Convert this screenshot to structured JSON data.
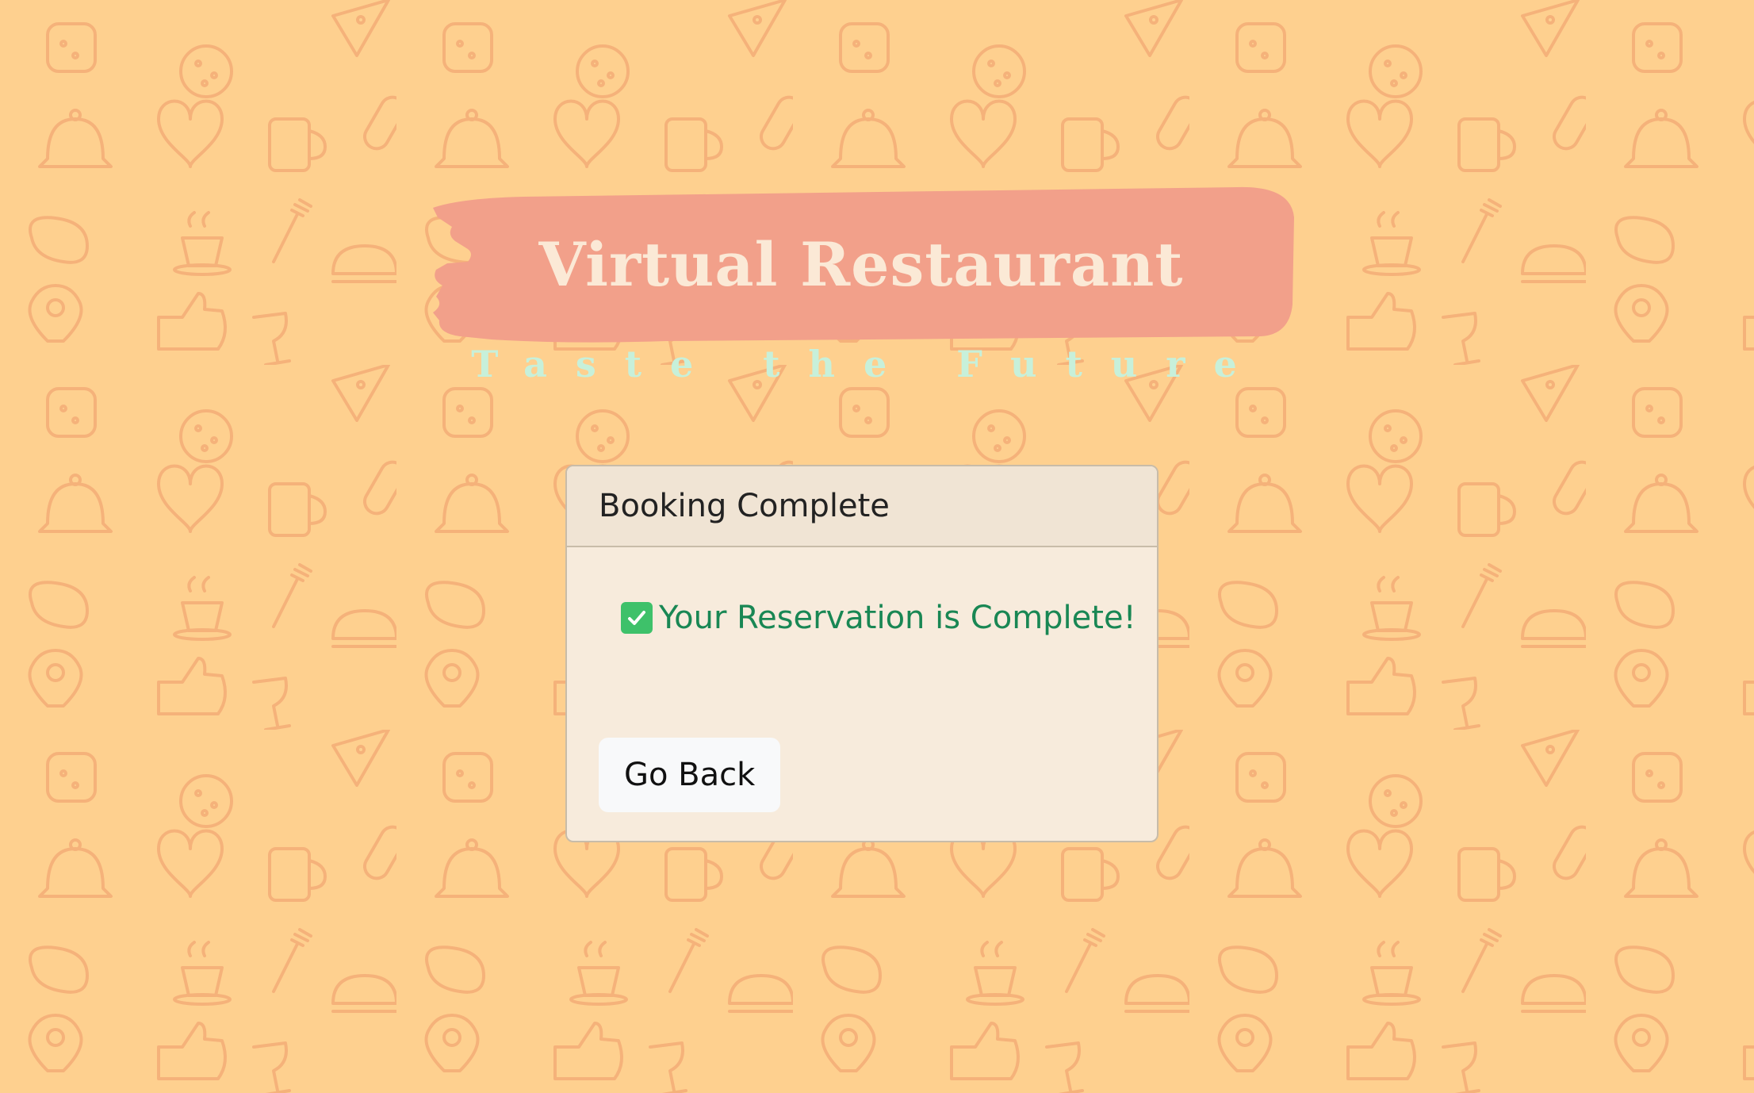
{
  "header": {
    "title": "Virtual Restaurant",
    "tagline": "Taste the Future"
  },
  "card": {
    "title": "Booking Complete",
    "status_icon": "check-mark-icon",
    "status_text": "Your Reservation is Complete!",
    "back_label": "Go Back"
  },
  "colors": {
    "background": "#fed08f",
    "banner": "#f2a08a",
    "title_text": "#fbe9d6",
    "tagline": "#c7f0da",
    "success": "#198754",
    "card_bg": "#f7ebdc",
    "card_header_bg": "#f0e4d4"
  }
}
